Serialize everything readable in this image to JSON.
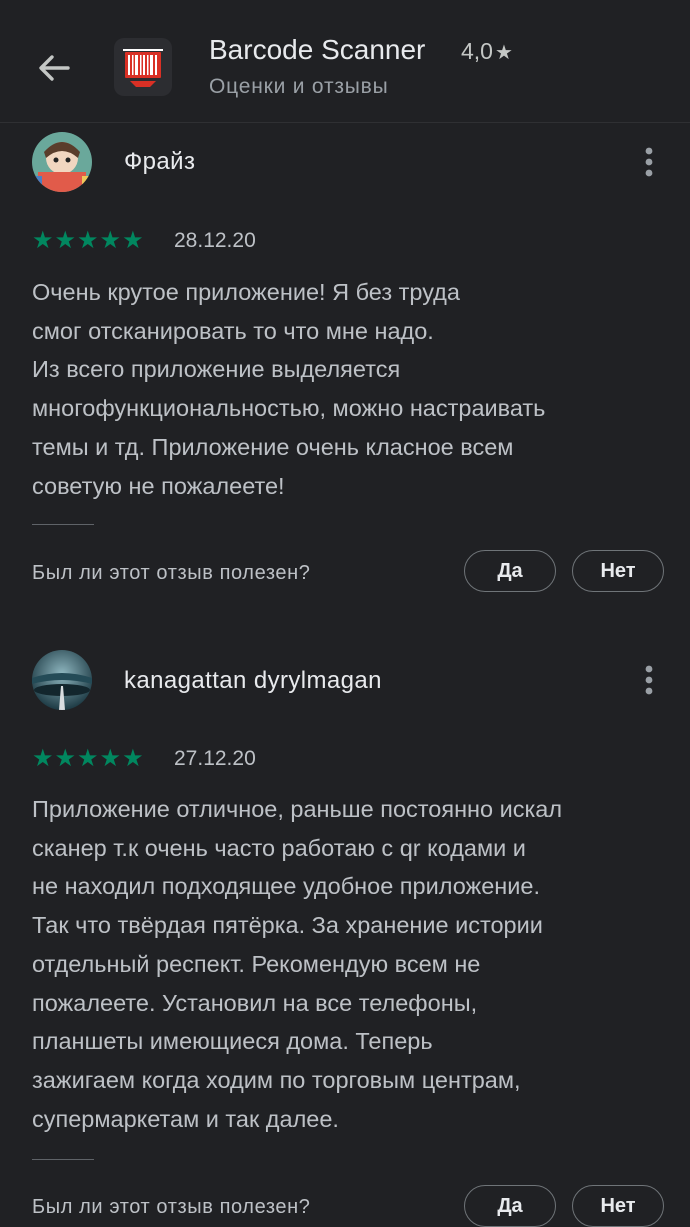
{
  "header": {
    "app_name": "Barcode Scanner",
    "rating": "4,0",
    "rating_star": "★",
    "subtitle": "Оценки и отзывы",
    "icons": {
      "back": "arrow-back-icon",
      "app": "barcode-app-icon",
      "rating": "star-icon"
    }
  },
  "reviews": [
    {
      "author": "Фрайз",
      "stars": "★★★★★",
      "star_count": 5,
      "date": "28.12.20",
      "lines": [
        "Очень крутое приложение! Я без труда",
        "смог отсканировать то что мне надо.",
        "Из всего приложение выделяется",
        "многофункциональностью, можно настраивать",
        "темы и тд. Приложение очень класное всем",
        "советую не пожалеете!"
      ],
      "helpful_question": "Был ли этот отзыв полезен?",
      "yes_label": "Да",
      "no_label": "Нет"
    },
    {
      "author": "kanagattan dyrylmagan",
      "stars": "★★★★★",
      "star_count": 5,
      "date": "27.12.20",
      "lines": [
        "Приложение отличное, раньше постоянно искал",
        "сканер т.к очень часто работаю с qr кодами и",
        "не находил подходящее удобное приложение.",
        "Так что твёрдая пятёрка. За хранение истории",
        "отдельный респект. Рекомендую всем не",
        "пожалеете. Установил на все телефоны,",
        "планшеты имеющиеся дома. Теперь",
        "зажигаем когда ходим по торговым центрам,",
        "супермаркетам и так далее."
      ],
      "helpful_question": "Был ли этот отзыв полезен?",
      "yes_label": "Да",
      "no_label": "Нет"
    }
  ],
  "colors": {
    "background": "#202124",
    "star_green": "#01875f",
    "barcode_red": "#d93025",
    "text_primary": "#e8eaed",
    "text_secondary": "#bdc1c6"
  }
}
